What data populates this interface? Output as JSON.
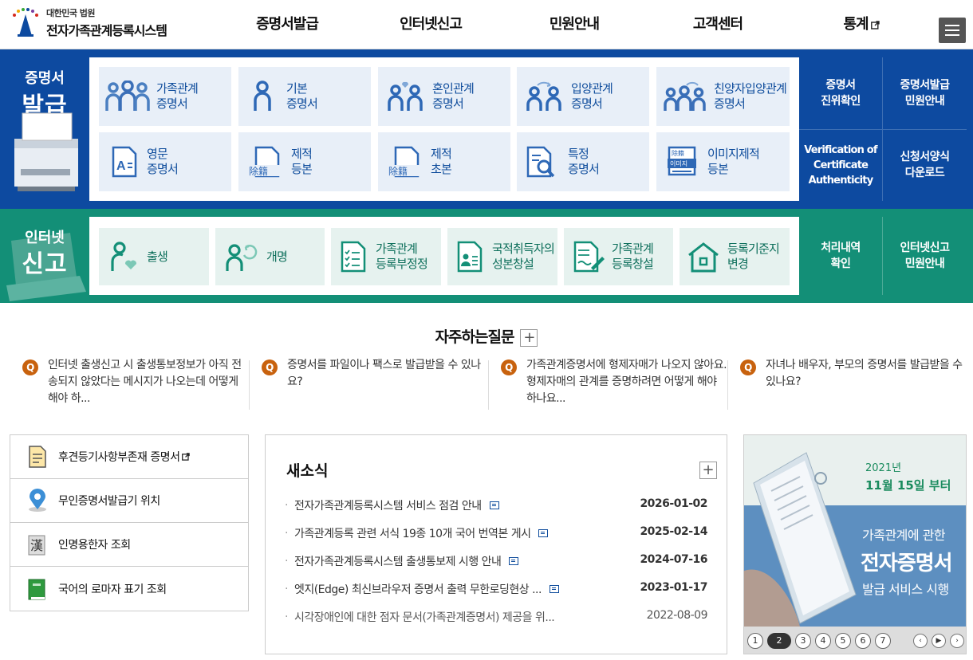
{
  "header": {
    "logo_line1": "대한민국 법원",
    "logo_line2": "전자가족관계등록시스템",
    "nav": [
      "증명서발급",
      "인터넷신고",
      "민원안내",
      "고객센터",
      "통계"
    ]
  },
  "certificate": {
    "title_small": "증명서",
    "title_large": "발급",
    "tiles": [
      {
        "label": "가족관계\n증명서",
        "icon": "family-people-icon"
      },
      {
        "label": "기본\n증명서",
        "icon": "person-icon"
      },
      {
        "label": "혼인관계\n증명서",
        "icon": "couple-heart-icon"
      },
      {
        "label": "입양관계\n증명서",
        "icon": "adoption-icon"
      },
      {
        "label": "친양자입양관계\n증명서",
        "icon": "family-arrow-icon"
      },
      {
        "label": "영문\n증명서",
        "icon": "english-document-icon"
      },
      {
        "label": "제적\n등본",
        "icon": "removed-register-icon"
      },
      {
        "label": "제적\n초본",
        "icon": "removed-register-icon"
      },
      {
        "label": "특정\n증명서",
        "icon": "magnifier-document-icon"
      },
      {
        "label": "이미지제적\n등본",
        "icon": "image-document-icon"
      }
    ],
    "tile_tags": {
      "removed": "除籍",
      "image_top": "除籍",
      "image_mid": "이미지"
    },
    "side": [
      "증명서\n진위확인",
      "증명서발급\n민원안내",
      "Verification of\nCertificate\nAuthenticity",
      "신청서양식\n다운로드"
    ]
  },
  "report": {
    "title_small": "인터넷",
    "title_large": "신고",
    "tiles": [
      {
        "label": "출생",
        "icon": "baby-icon"
      },
      {
        "label": "개명",
        "icon": "rename-icon"
      },
      {
        "label": "가족관계\n등록부정정",
        "icon": "checklist-icon"
      },
      {
        "label": "국적취득자의\n성본창설",
        "icon": "id-card-icon"
      },
      {
        "label": "가족관계\n등록창설",
        "icon": "pen-document-icon"
      },
      {
        "label": "등록기준지\n변경",
        "icon": "house-icon"
      }
    ],
    "side": [
      "처리내역\n확인",
      "인터넷신고\n민원안내"
    ]
  },
  "faq": {
    "title": "자주하는질문",
    "q_mark": "Q",
    "items": [
      "인터넷 출생신고 시 출생통보정보가 아직 전송되지 않았다는 메시지가 나오는데 어떻게 해야 하...",
      "증명서를 파일이나 팩스로 발급받을 수 있나요?",
      "가족관계증명서에 형제자매가 나오지 않아요. 형제자매의 관계를 증명하려면 어떻게 해야 하나요...",
      "자녀나 배우자, 부모의 증명서를 발급받을 수 있나요?"
    ]
  },
  "quick_links": [
    {
      "label": "후견등기사항부존재 증명서",
      "icon": "document-icon",
      "external": true
    },
    {
      "label": "무인증명서발급기 위치",
      "icon": "map-pin-icon",
      "external": false
    },
    {
      "label": "인명용한자 조회",
      "icon": "hanja-book-icon",
      "external": false
    },
    {
      "label": "국어의 로마자 표기 조회",
      "icon": "green-book-icon",
      "external": false
    }
  ],
  "hanja_glyph": "漢",
  "news": {
    "title": "새소식",
    "items": [
      {
        "title": "전자가족관계등록시스템 서비스 점검 안내",
        "date": "2026-01-02"
      },
      {
        "title": "가족관계등록 관련 서식 19종 10개 국어 번역본 게시",
        "date": "2025-02-14"
      },
      {
        "title": "전자가족관계등록시스템 출생통보제 시행 안내",
        "date": "2024-07-16"
      },
      {
        "title": "엣지(Edge) 최신브라우저 증명서 출력 무한로딩현상 ...",
        "date": "2023-01-17"
      },
      {
        "title": "시각장애인에 대한 점자 문서(가족관계증명서) 제공을 위...",
        "date": "2022-08-09"
      }
    ]
  },
  "banner": {
    "year": "2021년",
    "date": "11월 15일 부터",
    "line1": "가족관계에 관한",
    "line2": "전자증명서",
    "line3": "발급 서비스 시행",
    "pages": [
      "1",
      "2",
      "3",
      "4",
      "5",
      "6",
      "7"
    ],
    "active_page": "2",
    "prev": "‹",
    "pause": "▶",
    "next": "›"
  },
  "colors": {
    "blue": "#0d4aa0",
    "green": "#138f77",
    "accent": "#c8620e"
  }
}
